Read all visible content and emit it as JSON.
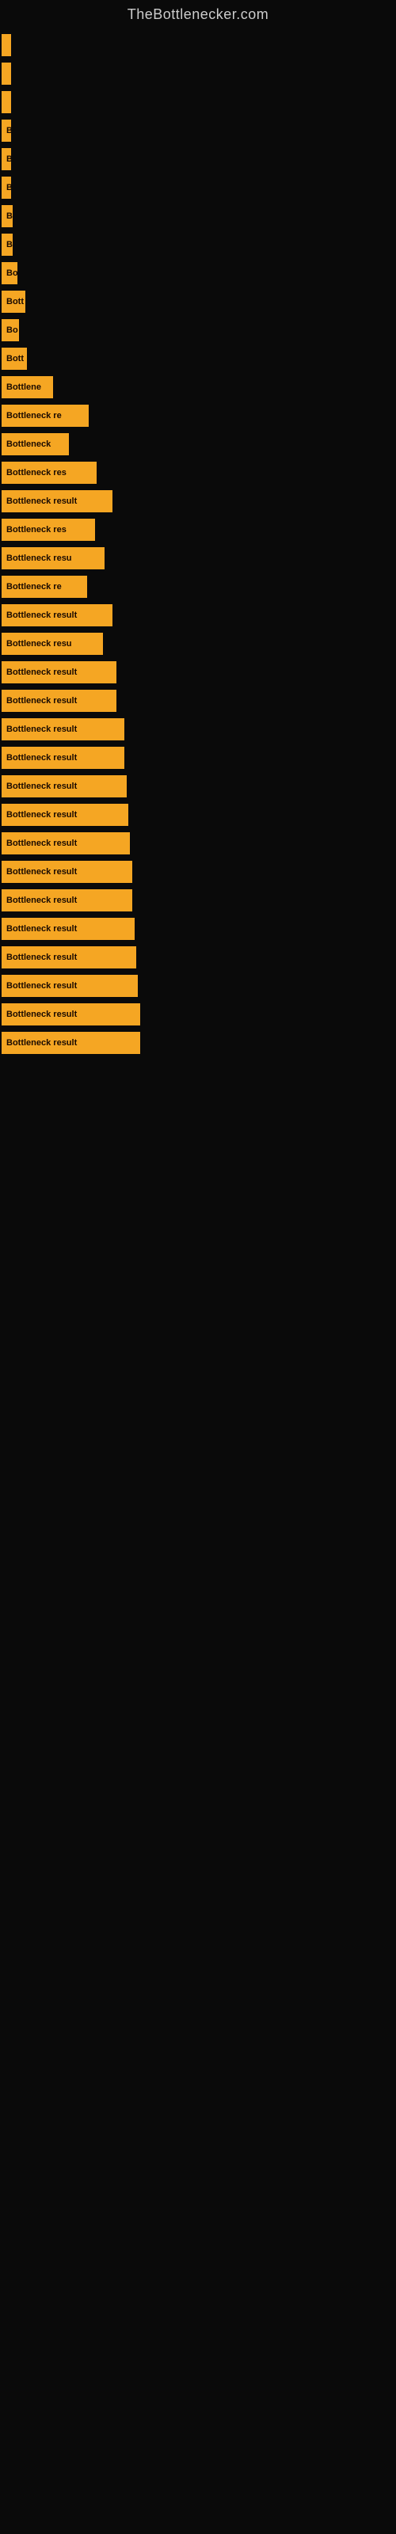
{
  "site_title": "TheBottlenecker.com",
  "bars": [
    {
      "label": "",
      "width": 2
    },
    {
      "label": "",
      "width": 3
    },
    {
      "label": "",
      "width": 3
    },
    {
      "label": "B",
      "width": 10
    },
    {
      "label": "B",
      "width": 10
    },
    {
      "label": "B",
      "width": 10
    },
    {
      "label": "B",
      "width": 14
    },
    {
      "label": "B",
      "width": 14
    },
    {
      "label": "Bo",
      "width": 20
    },
    {
      "label": "Bott",
      "width": 30
    },
    {
      "label": "Bo",
      "width": 22
    },
    {
      "label": "Bott",
      "width": 32
    },
    {
      "label": "Bottlene",
      "width": 65
    },
    {
      "label": "Bottleneck re",
      "width": 110
    },
    {
      "label": "Bottleneck",
      "width": 85
    },
    {
      "label": "Bottleneck res",
      "width": 120
    },
    {
      "label": "Bottleneck result",
      "width": 140
    },
    {
      "label": "Bottleneck res",
      "width": 118
    },
    {
      "label": "Bottleneck resu",
      "width": 130
    },
    {
      "label": "Bottleneck re",
      "width": 108
    },
    {
      "label": "Bottleneck result",
      "width": 140
    },
    {
      "label": "Bottleneck resu",
      "width": 128
    },
    {
      "label": "Bottleneck result",
      "width": 145
    },
    {
      "label": "Bottleneck result",
      "width": 145
    },
    {
      "label": "Bottleneck result",
      "width": 155
    },
    {
      "label": "Bottleneck result",
      "width": 155
    },
    {
      "label": "Bottleneck result",
      "width": 158
    },
    {
      "label": "Bottleneck result",
      "width": 160
    },
    {
      "label": "Bottleneck result",
      "width": 162
    },
    {
      "label": "Bottleneck result",
      "width": 165
    },
    {
      "label": "Bottleneck result",
      "width": 165
    },
    {
      "label": "Bottleneck result",
      "width": 168
    },
    {
      "label": "Bottleneck result",
      "width": 170
    },
    {
      "label": "Bottleneck result",
      "width": 172
    },
    {
      "label": "Bottleneck result",
      "width": 175
    },
    {
      "label": "Bottleneck result",
      "width": 175
    }
  ]
}
